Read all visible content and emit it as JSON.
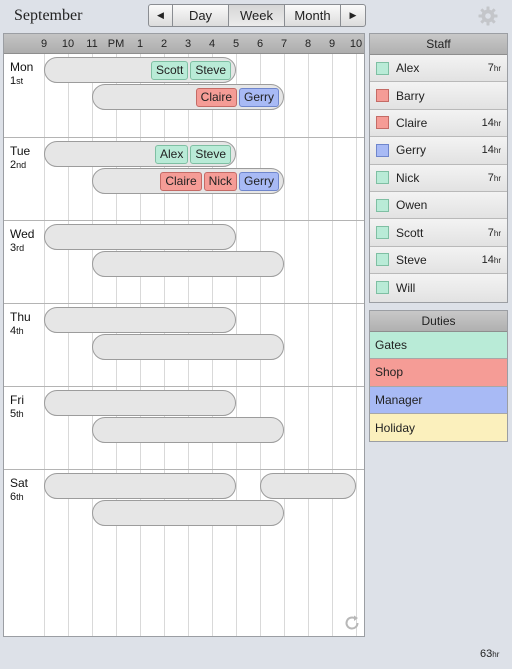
{
  "header": {
    "month": "September",
    "nav": {
      "prev_icon": "◀",
      "next_icon": "▶",
      "views": [
        "Day",
        "Week",
        "Month"
      ],
      "active_view": "Week"
    },
    "settings_icon": "gear-icon"
  },
  "colors": {
    "Gates": "#b9ebd7",
    "Shop": "#f59c96",
    "Manager": "#a8baf5",
    "Holiday": "#fbf0bd"
  },
  "calendar": {
    "hours": [
      "9",
      "10",
      "11",
      "PM",
      "1",
      "2",
      "3",
      "4",
      "5",
      "6",
      "7",
      "8",
      "9",
      "10"
    ],
    "hour_start": 9,
    "hour_end": 22,
    "days": [
      {
        "name": "Mon",
        "num": "1",
        "suffix": "st",
        "shifts": [
          {
            "start": 9,
            "end": 17,
            "lane": 0,
            "staff": [
              {
                "name": "Scott",
                "duty": "Gates"
              },
              {
                "name": "Steve",
                "duty": "Gates"
              }
            ]
          },
          {
            "start": 11,
            "end": 19,
            "lane": 1,
            "staff": [
              {
                "name": "Claire",
                "duty": "Shop"
              },
              {
                "name": "Gerry",
                "duty": "Manager"
              }
            ]
          }
        ]
      },
      {
        "name": "Tue",
        "num": "2",
        "suffix": "nd",
        "shifts": [
          {
            "start": 9,
            "end": 17,
            "lane": 0,
            "staff": [
              {
                "name": "Alex",
                "duty": "Gates"
              },
              {
                "name": "Steve",
                "duty": "Gates"
              }
            ]
          },
          {
            "start": 11,
            "end": 19,
            "lane": 1,
            "staff": [
              {
                "name": "Claire",
                "duty": "Shop"
              },
              {
                "name": "Nick",
                "duty": "Shop"
              },
              {
                "name": "Gerry",
                "duty": "Manager"
              }
            ]
          }
        ]
      },
      {
        "name": "Wed",
        "num": "3",
        "suffix": "rd",
        "shifts": [
          {
            "start": 9,
            "end": 17,
            "lane": 0,
            "staff": []
          },
          {
            "start": 11,
            "end": 19,
            "lane": 1,
            "staff": []
          }
        ]
      },
      {
        "name": "Thu",
        "num": "4",
        "suffix": "th",
        "shifts": [
          {
            "start": 9,
            "end": 17,
            "lane": 0,
            "staff": []
          },
          {
            "start": 11,
            "end": 19,
            "lane": 1,
            "staff": []
          }
        ]
      },
      {
        "name": "Fri",
        "num": "5",
        "suffix": "th",
        "shifts": [
          {
            "start": 9,
            "end": 17,
            "lane": 0,
            "staff": []
          },
          {
            "start": 11,
            "end": 19,
            "lane": 1,
            "staff": []
          }
        ]
      },
      {
        "name": "Sat",
        "num": "6",
        "suffix": "th",
        "shifts": [
          {
            "start": 9,
            "end": 17,
            "lane": 0,
            "staff": []
          },
          {
            "start": 18,
            "end": 22,
            "lane": 0,
            "staff": []
          },
          {
            "start": 11,
            "end": 19,
            "lane": 1,
            "staff": []
          }
        ]
      }
    ],
    "refresh_icon": "refresh-icon"
  },
  "staff_panel": {
    "title": "Staff",
    "hr_unit": "hr",
    "items": [
      {
        "name": "Alex",
        "duty": "Gates",
        "hours": "7"
      },
      {
        "name": "Barry",
        "duty": "Shop",
        "hours": ""
      },
      {
        "name": "Claire",
        "duty": "Shop",
        "hours": "14"
      },
      {
        "name": "Gerry",
        "duty": "Manager",
        "hours": "14"
      },
      {
        "name": "Nick",
        "duty": "Gates",
        "hours": "7"
      },
      {
        "name": "Owen",
        "duty": "Gates",
        "hours": ""
      },
      {
        "name": "Scott",
        "duty": "Gates",
        "hours": "7"
      },
      {
        "name": "Steve",
        "duty": "Gates",
        "hours": "14"
      },
      {
        "name": "Will",
        "duty": "Gates",
        "hours": ""
      }
    ]
  },
  "duties_panel": {
    "title": "Duties",
    "items": [
      "Gates",
      "Shop",
      "Manager",
      "Holiday"
    ]
  },
  "footer": {
    "total_hours": "63",
    "unit": "hr"
  }
}
